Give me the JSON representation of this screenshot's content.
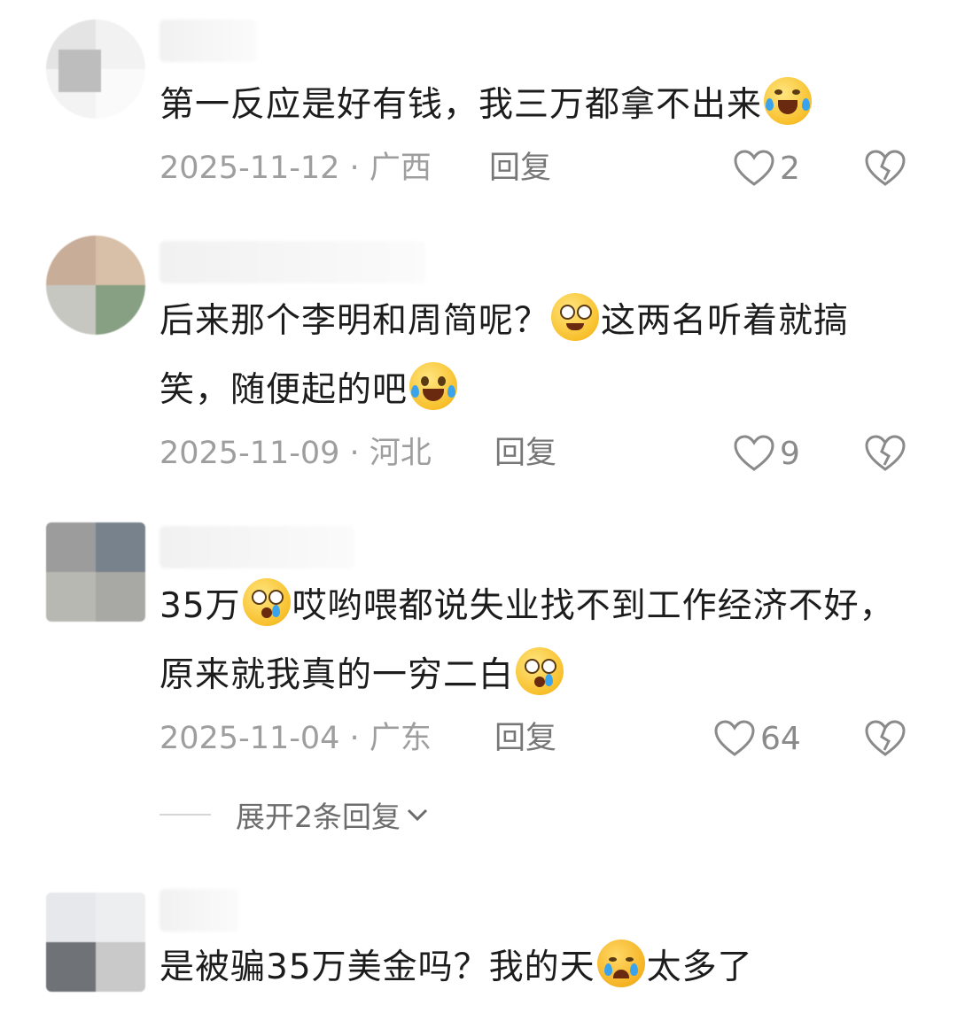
{
  "comments": [
    {
      "text_a": "第一反应是好有钱，我三万都拿不出来",
      "date": "2025-11-12",
      "region": "广西",
      "reply_label": "回复",
      "likes": "2"
    },
    {
      "text_a": "后来那个李明和周简呢？",
      "text_b": "这两名听着就搞笑，随便起的吧",
      "date": "2025-11-09",
      "region": "河北",
      "reply_label": "回复",
      "likes": "9"
    },
    {
      "text_a": "35万",
      "text_b": "哎哟喂都说失业找不到工作经济不好，原来就我真的一穷二白",
      "date": "2025-11-04",
      "region": "广东",
      "reply_label": "回复",
      "likes": "64"
    },
    {
      "text_a": "是被骗35万美金吗？我的天",
      "text_b": "太多了"
    }
  ],
  "expand_replies_label": "展开2条回复",
  "separator": "·",
  "icons": {
    "like": "heart-outline-icon",
    "dislike": "broken-heart-icon",
    "expand": "chevron-down-icon"
  },
  "colors": {
    "text": "#1c1c1c",
    "meta": "#9e9e9e",
    "emoji": "#f8c02c"
  }
}
